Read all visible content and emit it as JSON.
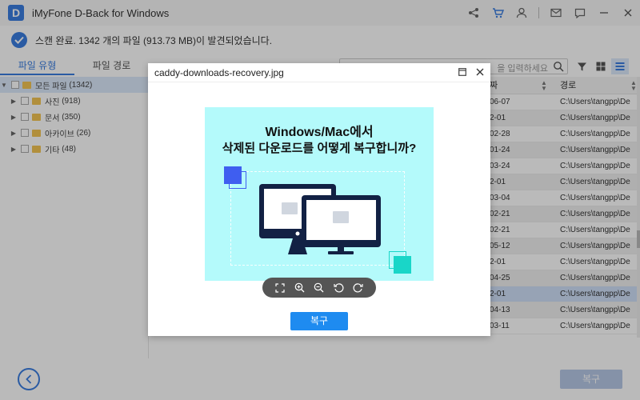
{
  "app": {
    "logo": "D",
    "title": "iMyFone D-Back for Windows"
  },
  "titlebar_icons": [
    "share-icon",
    "cart-icon",
    "user-icon",
    "mail-icon",
    "chat-icon",
    "minimize-icon",
    "close-icon"
  ],
  "status": {
    "text": "스캔 완료. 1342 개의 파일 (913.73 MB)이 발견되었습니다."
  },
  "tabs": [
    {
      "label": "파일 유형"
    },
    {
      "label": "파일 경로"
    }
  ],
  "tree": {
    "root": {
      "label": "모든 파일",
      "count": "(1342)"
    },
    "children": [
      {
        "label": "사진",
        "count": "(918)"
      },
      {
        "label": "문서",
        "count": "(350)"
      },
      {
        "label": "아카이브",
        "count": "(26)"
      },
      {
        "label": "기타",
        "count": "(48)"
      }
    ]
  },
  "search": {
    "placeholder": "을 입력하세요"
  },
  "table": {
    "headers": {
      "date": "짜",
      "path": "경로"
    },
    "rows": [
      {
        "date": "06-07",
        "path": "C:\\Users\\tangpp\\De"
      },
      {
        "date": "2-01",
        "path": "C:\\Users\\tangpp\\De"
      },
      {
        "date": "02-28",
        "path": "C:\\Users\\tangpp\\De"
      },
      {
        "date": "01-24",
        "path": "C:\\Users\\tangpp\\De"
      },
      {
        "date": "03-24",
        "path": "C:\\Users\\tangpp\\De"
      },
      {
        "date": "2-01",
        "path": "C:\\Users\\tangpp\\De"
      },
      {
        "date": "03-04",
        "path": "C:\\Users\\tangpp\\De"
      },
      {
        "date": "02-21",
        "path": "C:\\Users\\tangpp\\De"
      },
      {
        "date": "02-21",
        "path": "C:\\Users\\tangpp\\De"
      },
      {
        "date": "05-12",
        "path": "C:\\Users\\tangpp\\De"
      },
      {
        "date": "2-01",
        "path": "C:\\Users\\tangpp\\De"
      },
      {
        "date": "04-25",
        "path": "C:\\Users\\tangpp\\De"
      },
      {
        "date": "2-01",
        "path": "C:\\Users\\tangpp\\De",
        "selected": true
      },
      {
        "date": "04-13",
        "path": "C:\\Users\\tangpp\\De"
      },
      {
        "date": "03-11",
        "path": "C:\\Users\\tangpp\\De"
      }
    ]
  },
  "bottom": {
    "recover_label": "복구"
  },
  "modal": {
    "title": "caddy-downloads-recovery.jpg",
    "preview": {
      "line1": "Windows/Mac에서",
      "line2": "삭제된 다운로드를 어떻게 복구합니까?"
    },
    "recover_label": "복구"
  },
  "colors": {
    "accent": "#3a7de0",
    "preview_bg": "#b4fafb",
    "recover_button": "#1e8bf0"
  }
}
